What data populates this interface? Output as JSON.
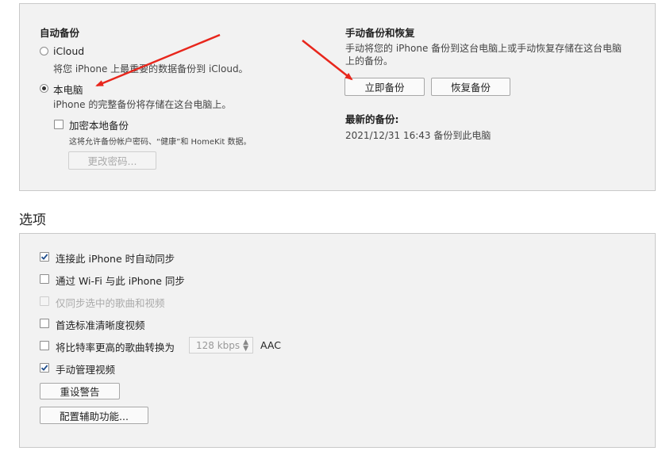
{
  "backup": {
    "auto_title": "自动备份",
    "icloud_label": "iCloud",
    "icloud_desc": "将您 iPhone 上最重要的数据备份到 iCloud。",
    "local_label": "本电脑",
    "local_desc": "iPhone 的完整备份将存储在这台电脑上。",
    "encrypt_label": "加密本地备份",
    "encrypt_desc": "这将允许备份帐户密码、“健康”和 HomeKit 数据。",
    "change_password_label": "更改密码...",
    "manual_title": "手动备份和恢复",
    "manual_desc": "手动将您的 iPhone 备份到这台电脑上或手动恢复存储在这台电脑上的备份。",
    "backup_now_label": "立即备份",
    "restore_label": "恢复备份",
    "latest_title": "最新的备份:",
    "latest_value": "2021/12/31 16:43 备份到此电脑"
  },
  "options": {
    "title": "选项",
    "items": [
      {
        "label": "连接此 iPhone 时自动同步",
        "checked": true
      },
      {
        "label": "通过 Wi-Fi 与此 iPhone 同步",
        "checked": false
      },
      {
        "label": "仅同步选中的歌曲和视频",
        "checked": false,
        "disabled": true
      },
      {
        "label": "首选标准清晰度视频",
        "checked": false
      },
      {
        "label": "将比特率更高的歌曲转换为",
        "checked": false
      },
      {
        "label": "手动管理视频",
        "checked": true
      }
    ],
    "bitrate_value": "128 kbps",
    "bitrate_format": "AAC",
    "reset_warnings_label": "重设警告",
    "accessibility_label": "配置辅助功能..."
  },
  "colors": {
    "arrow": "#e8261c",
    "panel_bg": "#f2f2f2",
    "panel_border": "#c9c9c9"
  }
}
